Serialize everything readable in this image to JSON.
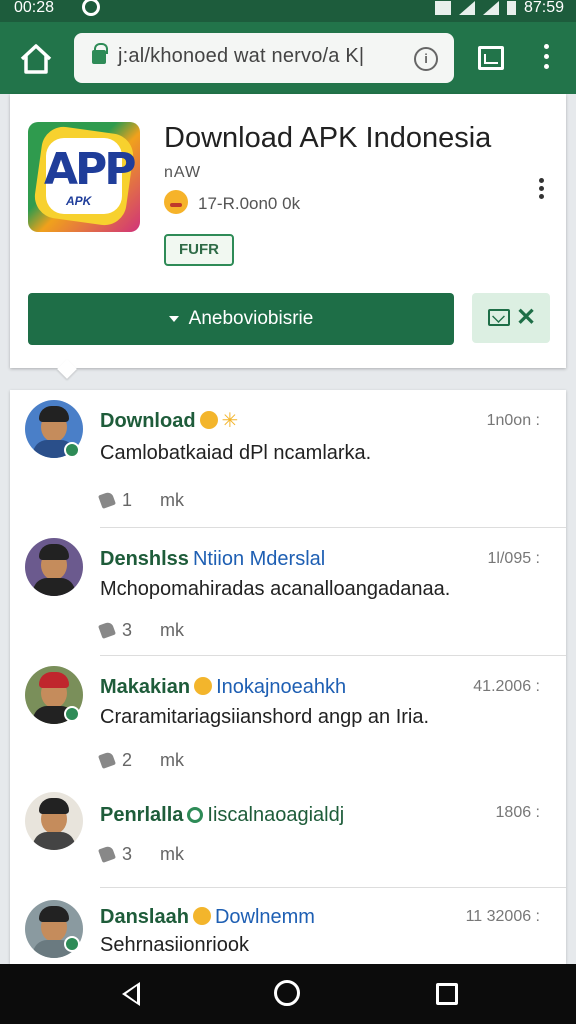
{
  "status_bar": {
    "time": "00:28",
    "clock": "87:59"
  },
  "browser": {
    "url": "j:al/khonoed wat nervo/a K|"
  },
  "app": {
    "title": "Download APK Indonesia",
    "developer": "nAW",
    "rating_text": "17-R.0on0 0k",
    "badge": "FUFR",
    "install_label": "Aneboviobisrie",
    "logo_text": "APP",
    "logo_sub": "APK"
  },
  "posts": [
    {
      "name": "Download",
      "tag": "",
      "time": "1n0on :",
      "text": "Camlobatkaiad dPl ncamlarka.",
      "likes": "1",
      "more": "mk"
    },
    {
      "name": "Denshlss",
      "tag": "Ntiion Mderslal",
      "time": "1l/095 :",
      "text": "Mchopomahiradas acanalloangadanaa.",
      "likes": "3",
      "more": "mk"
    },
    {
      "name": "Makakian",
      "tag": "Inokajnoeahkh",
      "time": "41.2006 :",
      "text": "Craramitariagsiianshord angp an Iria.",
      "likes": "2",
      "more": "mk"
    },
    {
      "name": "Penrlalla",
      "tag": "Iiscalnaoagialdj",
      "time": "1806 :",
      "text": "",
      "likes": "3",
      "more": "mk"
    },
    {
      "name": "Danslaah",
      "tag": "Dowlnemm",
      "time": "11 32006 :",
      "text": "Sehrnasiionriook",
      "likes": "",
      "more": ""
    }
  ],
  "colors": {
    "toolbar": "#22744a",
    "status": "#1d5c3c",
    "accent": "#1e6e47",
    "link": "#1e5fb3"
  }
}
